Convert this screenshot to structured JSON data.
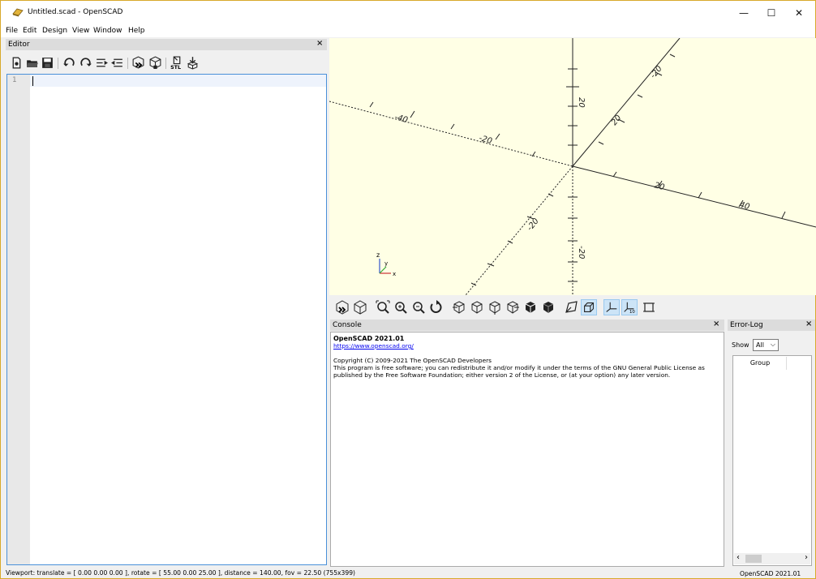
{
  "window": {
    "title": "Untitled.scad - OpenSCAD",
    "controls": [
      "—",
      "☐",
      "✕"
    ]
  },
  "menu": [
    "File",
    "Edit",
    "Design",
    "View",
    "Window",
    "Help"
  ],
  "editor": {
    "panel_title": "Editor",
    "close_glyph": "×",
    "line_number": "1",
    "toolbar_icons": [
      "new-file-icon",
      "open-file-icon",
      "save-icon",
      "undo-icon",
      "redo-icon",
      "unindent-icon",
      "indent-icon",
      "preview-icon",
      "render-icon",
      "export-stl-icon",
      "send-to-print-icon"
    ]
  },
  "viewport": {
    "axis_labels": [
      "-40",
      "-20",
      "20",
      "40",
      "20",
      "-20",
      "20",
      "-20",
      "-20"
    ],
    "corner_axes": {
      "z": "z",
      "y": "y",
      "x": "x"
    },
    "toolbar_icons": [
      "preview-icon",
      "render-icon",
      "view-all-icon",
      "zoom-in-icon",
      "zoom-out-icon",
      "reset-view-icon",
      "right-view-icon",
      "top-view-icon",
      "bottom-view-icon",
      "left-view-icon",
      "front-view-icon",
      "back-view-icon",
      "perspective-icon",
      "orthogonal-icon",
      "show-axes-icon",
      "show-scale-icon",
      "show-edges-icon"
    ]
  },
  "console": {
    "panel_title": "Console",
    "close_glyph": "×",
    "version_line": "OpenSCAD 2021.01",
    "link": "https://www.openscad.org/",
    "copyright": "Copyright (C) 2009-2021 The OpenSCAD Developers",
    "license": "This program is free software; you can redistribute it and/or modify it under the terms of the GNU General Public License as published by the Free Software Foundation; either version 2 of the License, or (at your option) any later version."
  },
  "error_log": {
    "panel_title": "Error-Log",
    "close_glyph": "×",
    "show_label": "Show",
    "show_value": "All",
    "column_header": "Group",
    "scroll_left": "‹",
    "scroll_right": "›"
  },
  "status": {
    "viewport_info": "Viewport: translate = [ 0.00 0.00 0.00 ], rotate = [ 55.00 0.00 25.00 ], distance = 140.00, fov = 22.50 (755x399)",
    "version": "OpenSCAD 2021.01"
  },
  "colors": {
    "viewport_bg": "#ffffe5",
    "accent": "#4a90d9",
    "title_border": "#d8a92a"
  }
}
